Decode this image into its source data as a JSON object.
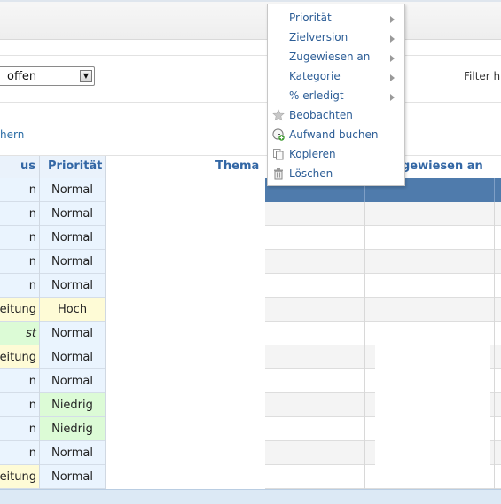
{
  "filter": {
    "status_value": "offen",
    "filter_label": "Filter hi"
  },
  "link_text": "hern",
  "table": {
    "headers": {
      "status": "us",
      "priority": "Priorität",
      "subject": "Thema",
      "assigned": "gewiesen an"
    },
    "rows": [
      {
        "status": "n",
        "status_style": "normal",
        "priority": "Normal",
        "priority_style": "normal"
      },
      {
        "status": "n",
        "status_style": "normal",
        "priority": "Normal",
        "priority_style": "normal"
      },
      {
        "status": "n",
        "status_style": "normal",
        "priority": "Normal",
        "priority_style": "normal"
      },
      {
        "status": "n",
        "status_style": "normal",
        "priority": "Normal",
        "priority_style": "normal"
      },
      {
        "status": "n",
        "status_style": "normal",
        "priority": "Normal",
        "priority_style": "normal"
      },
      {
        "status": "eitung",
        "status_style": "hoch",
        "priority": "Hoch",
        "priority_style": "hoch"
      },
      {
        "status": "st",
        "status_style": "niedrig",
        "status_italic": true,
        "priority": "Normal",
        "priority_style": "normal"
      },
      {
        "status": "eitung",
        "status_style": "hoch",
        "priority": "Normal",
        "priority_style": "normal"
      },
      {
        "status": "n",
        "status_style": "normal",
        "priority": "Normal",
        "priority_style": "normal"
      },
      {
        "status": "n",
        "status_style": "normal",
        "priority": "Niedrig",
        "priority_style": "niedrig"
      },
      {
        "status": "n",
        "status_style": "normal",
        "priority": "Niedrig",
        "priority_style": "niedrig"
      },
      {
        "status": "n",
        "status_style": "normal",
        "priority": "Normal",
        "priority_style": "normal"
      },
      {
        "status": "eitung",
        "status_style": "hoch",
        "priority": "Normal",
        "priority_style": "normal"
      }
    ]
  },
  "context_menu": {
    "items": [
      {
        "label": "Priorität",
        "icon": "",
        "submenu": true
      },
      {
        "label": "Zielversion",
        "icon": "",
        "submenu": true
      },
      {
        "label": "Zugewiesen an",
        "icon": "",
        "submenu": true
      },
      {
        "label": "Kategorie",
        "icon": "",
        "submenu": true
      },
      {
        "label": "% erledigt",
        "icon": "",
        "submenu": true
      },
      {
        "label": "Beobachten",
        "icon": "star-icon",
        "submenu": false
      },
      {
        "label": "Aufwand buchen",
        "icon": "clock-add-icon",
        "submenu": false
      },
      {
        "label": "Kopieren",
        "icon": "copy-icon",
        "submenu": false
      },
      {
        "label": "Löschen",
        "icon": "trash-icon",
        "submenu": false
      }
    ]
  },
  "colors": {
    "normal_bg": "#eaf4fe",
    "hoch_bg": "#fefbd6",
    "niedrig_bg": "#dcfbd6",
    "header_text": "#3367a5",
    "header_bar": "#4f7bac",
    "link": "#2c6ea6"
  }
}
